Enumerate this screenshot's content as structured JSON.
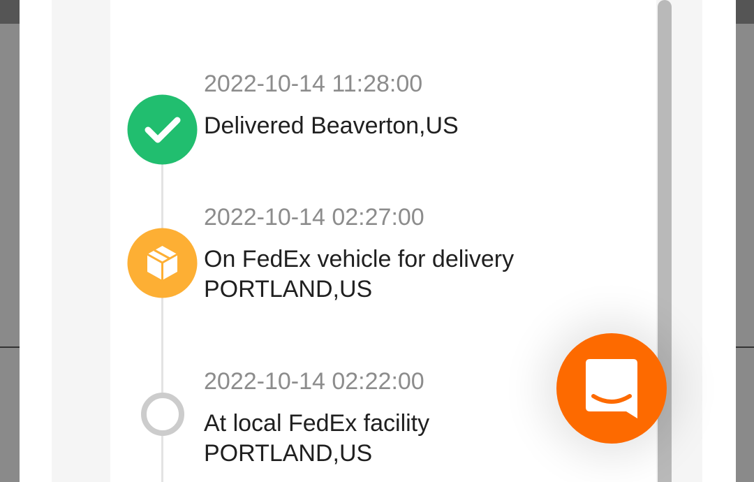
{
  "tracking": {
    "events": [
      {
        "time": "2022-10-14 11:28:00",
        "line1": "Delivered Beaverton,US",
        "line2": "",
        "status": "delivered",
        "icon": "check-icon",
        "color": "#21be6f"
      },
      {
        "time": "2022-10-14 02:27:00",
        "line1": "On FedEx vehicle for delivery",
        "line2": "PORTLAND,US",
        "status": "out-for-delivery",
        "icon": "package-icon",
        "color": "#fdaf34"
      },
      {
        "time": "2022-10-14 02:22:00",
        "line1": "At local FedEx facility",
        "line2": "PORTLAND,US",
        "status": "in-transit",
        "icon": "circle-icon",
        "color": "#cccccc"
      }
    ]
  },
  "chat": {
    "icon": "chat-smile-icon",
    "color": "#fd6a00"
  }
}
